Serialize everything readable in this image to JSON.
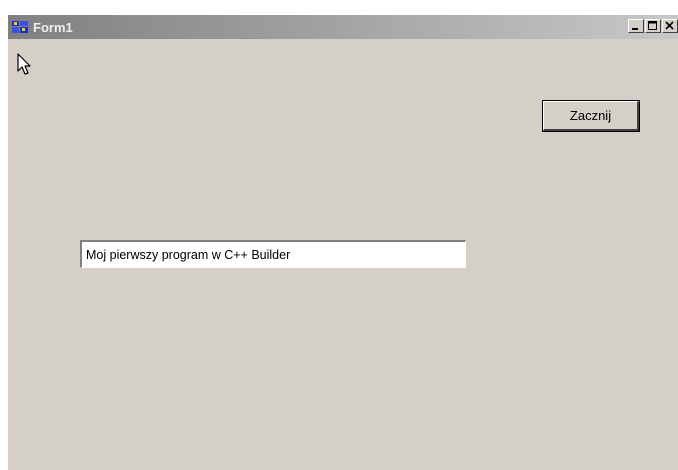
{
  "window": {
    "title": "Form1",
    "icon": "cpp-builder-app-icon",
    "controls": {
      "minimize_icon": "minimize-icon",
      "maximize_icon": "maximize-icon",
      "close_icon": "close-icon"
    }
  },
  "form": {
    "start_button_label": "Zacznij",
    "text_field_value": "Moj pierwszy program w C++ Builder"
  },
  "colors": {
    "face": "#d4d0c8",
    "titlebar_inactive": "#808080"
  }
}
